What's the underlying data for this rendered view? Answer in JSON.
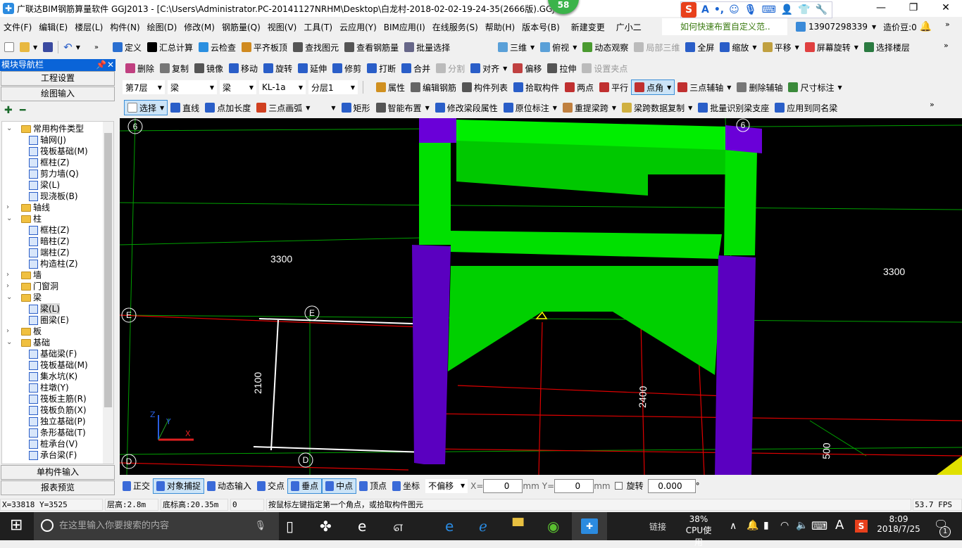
{
  "title": "广联达BIM钢筋算量软件 GGJ2013 - [C:\\Users\\Administrator.PC-20141127NRHM\\Desktop\\白龙村-2018-02-02-19-24-35(2666版).GGJ12]",
  "badge": "58",
  "window_controls": {
    "minimize": "—",
    "maximize": "❐",
    "close": "✕"
  },
  "ime_bar": {
    "logo": "S",
    "mode": "A"
  },
  "menu": [
    "文件(F)",
    "编辑(E)",
    "楼层(L)",
    "构件(N)",
    "绘图(D)",
    "修改(M)",
    "钢筋量(Q)",
    "视图(V)",
    "工具(T)",
    "云应用(Y)",
    "BIM应用(I)",
    "在线服务(S)",
    "帮助(H)",
    "版本号(B)",
    "新建变更",
    "广小二"
  ],
  "tip_link": "如何快速布置自定义范..",
  "account": {
    "phone": "13907298339",
    "beans": "造价豆:0"
  },
  "toolbar1": [
    {
      "label": "定义",
      "color": "#2a6fd0"
    },
    {
      "label": "汇总计算",
      "color": "#000"
    },
    {
      "label": "云检查",
      "color": "#2a8fe0"
    },
    {
      "label": "平齐板顶",
      "color": "#d08a20"
    },
    {
      "label": "查找图元",
      "color": "#555"
    },
    {
      "label": "查看钢筋量",
      "color": "#555"
    },
    {
      "label": "批量选择",
      "color": "#668"
    }
  ],
  "toolbar1b": [
    {
      "label": "三维",
      "color": "#5aa0d8"
    },
    {
      "label": "俯视",
      "color": "#5aa0d8"
    },
    {
      "label": "动态观察",
      "color": "#4a9a30"
    },
    {
      "label": "局部三维",
      "color": "#bbb",
      "disabled": true
    },
    {
      "label": "全屏",
      "color": "#2a5ec8"
    },
    {
      "label": "缩放",
      "color": "#2a5ec8"
    },
    {
      "label": "平移",
      "color": "#c0a040"
    },
    {
      "label": "屏幕旋转",
      "color": "#e04040"
    },
    {
      "label": "选择楼层",
      "color": "#2a7a40"
    }
  ],
  "toolbar2": [
    {
      "label": "删除",
      "color": "#c04080"
    },
    {
      "label": "复制",
      "color": "#777"
    },
    {
      "label": "镜像",
      "color": "#555"
    },
    {
      "label": "移动",
      "color": "#2a5ec8"
    },
    {
      "label": "旋转",
      "color": "#2a5ec8"
    },
    {
      "label": "延伸",
      "color": "#2a5ec8"
    },
    {
      "label": "修剪",
      "color": "#2a5ec8"
    },
    {
      "label": "打断",
      "color": "#2a5ec8"
    },
    {
      "label": "合并",
      "color": "#2a5ec8"
    },
    {
      "label": "分割",
      "color": "#bbb",
      "disabled": true
    },
    {
      "label": "对齐",
      "color": "#2a5ec8"
    },
    {
      "label": "偏移",
      "color": "#c04040"
    },
    {
      "label": "拉伸",
      "color": "#555"
    },
    {
      "label": "设置夹点",
      "color": "#bbb",
      "disabled": true
    }
  ],
  "selectors": [
    {
      "value": "第7层"
    },
    {
      "value": "梁"
    },
    {
      "value": "梁"
    },
    {
      "value": "KL-1a"
    },
    {
      "value": "分层1"
    }
  ],
  "toolbar3": [
    {
      "label": "属性",
      "color": "#d09020"
    },
    {
      "label": "编辑钢筋",
      "color": "#666"
    },
    {
      "label": "构件列表",
      "color": "#555"
    },
    {
      "label": "拾取构件",
      "color": "#2a5ec8"
    },
    {
      "label": "两点",
      "color": "#c03030"
    },
    {
      "label": "平行",
      "color": "#c03030"
    },
    {
      "label": "点角",
      "color": "#c03030",
      "active": true
    },
    {
      "label": "三点辅轴",
      "color": "#c03030"
    },
    {
      "label": "删除辅轴",
      "color": "#777"
    },
    {
      "label": "尺寸标注",
      "color": "#3a8a3a"
    }
  ],
  "toolbar4": [
    {
      "label": "选择",
      "color": "#fff",
      "active": true
    },
    {
      "label": "直线",
      "color": "#2a5ec8"
    },
    {
      "label": "点加长度",
      "color": "#2a5ec8"
    },
    {
      "label": "三点画弧",
      "color": "#d04020"
    },
    {
      "label": "",
      "color": "transparent"
    },
    {
      "label": "矩形",
      "color": "#2a5ec8"
    },
    {
      "label": "智能布置",
      "color": "#555"
    },
    {
      "label": "修改梁段属性",
      "color": "#2a5ec8"
    },
    {
      "label": "原位标注",
      "color": "#2a5ec8"
    },
    {
      "label": "重提梁跨",
      "color": "#c08040"
    },
    {
      "label": "梁跨数据复制",
      "color": "#d0b040"
    },
    {
      "label": "批量识别梁支座",
      "color": "#2a5ec8"
    },
    {
      "label": "应用到同名梁",
      "color": "#2a5ec8"
    }
  ],
  "sidebar": {
    "title": "模块导航栏",
    "buttons": [
      "工程设置",
      "绘图输入"
    ],
    "bottom_buttons": [
      "单构件输入",
      "报表预览"
    ],
    "tree": [
      {
        "label": "常用构件类型",
        "level": 0,
        "folder": true,
        "open": true
      },
      {
        "label": "轴网(J)",
        "level": 1
      },
      {
        "label": "筏板基础(M)",
        "level": 1
      },
      {
        "label": "框柱(Z)",
        "level": 1
      },
      {
        "label": "剪力墙(Q)",
        "level": 1
      },
      {
        "label": "梁(L)",
        "level": 1
      },
      {
        "label": "现浇板(B)",
        "level": 1
      },
      {
        "label": "轴线",
        "level": 0,
        "folder": true,
        "open": false
      },
      {
        "label": "柱",
        "level": 0,
        "folder": true,
        "open": true
      },
      {
        "label": "框柱(Z)",
        "level": 1
      },
      {
        "label": "暗柱(Z)",
        "level": 1
      },
      {
        "label": "端柱(Z)",
        "level": 1
      },
      {
        "label": "构造柱(Z)",
        "level": 1
      },
      {
        "label": "墙",
        "level": 0,
        "folder": true,
        "open": false
      },
      {
        "label": "门窗洞",
        "level": 0,
        "folder": true,
        "open": false
      },
      {
        "label": "梁",
        "level": 0,
        "folder": true,
        "open": true
      },
      {
        "label": "梁(L)",
        "level": 1,
        "selected": true
      },
      {
        "label": "圈梁(E)",
        "level": 1
      },
      {
        "label": "板",
        "level": 0,
        "folder": true,
        "open": false
      },
      {
        "label": "基础",
        "level": 0,
        "folder": true,
        "open": true
      },
      {
        "label": "基础梁(F)",
        "level": 1
      },
      {
        "label": "筏板基础(M)",
        "level": 1
      },
      {
        "label": "集水坑(K)",
        "level": 1
      },
      {
        "label": "柱墩(Y)",
        "level": 1
      },
      {
        "label": "筏板主筋(R)",
        "level": 1
      },
      {
        "label": "筏板负筋(X)",
        "level": 1
      },
      {
        "label": "独立基础(P)",
        "level": 1
      },
      {
        "label": "条形基础(T)",
        "level": 1
      },
      {
        "label": "桩承台(V)",
        "level": 1
      },
      {
        "label": "承台梁(F)",
        "level": 1
      }
    ]
  },
  "canvas": {
    "dims": [
      "3300",
      "3300",
      "2100",
      "2400",
      "500"
    ],
    "axis_labels": [
      "6",
      "E",
      "E",
      "D",
      "D",
      "6"
    ],
    "ucs": {
      "x": "X",
      "y": "Y",
      "z": "Z"
    },
    "colors": {
      "beam": "#00e000",
      "column": "#6a00d8",
      "background": "#000000"
    }
  },
  "snapbar": {
    "items": [
      {
        "label": "正交"
      },
      {
        "label": "对象捕捉",
        "active": true
      },
      {
        "label": "动态输入"
      },
      {
        "label": "交点"
      },
      {
        "label": "垂点",
        "active": true
      },
      {
        "label": "中点",
        "active": true
      },
      {
        "label": "顶点"
      },
      {
        "label": "坐标"
      }
    ],
    "offset_mode": "不偏移",
    "x_label": "X=",
    "x_value": "0",
    "y_label": "Y=",
    "y_value": "0",
    "unit": "mm",
    "rotate_label": "旋转",
    "rotate_value": "0.000",
    "degree": "°"
  },
  "status": {
    "coords": "X=33818 Y=3525",
    "floor_height": "层高:2.8m",
    "base_elev": "底标高:20.35m",
    "zero": "0",
    "hint": "按鼠标左键指定第一个角点，或拾取构件图元",
    "fps": "53.7 FPS"
  },
  "taskbar": {
    "search_placeholder": "在这里输入你要搜索的内容",
    "link": "链接",
    "cpu_percent": "38%",
    "cpu_label": "CPU使用",
    "time": "8:09",
    "date": "2018/7/25",
    "notifications": "1"
  }
}
